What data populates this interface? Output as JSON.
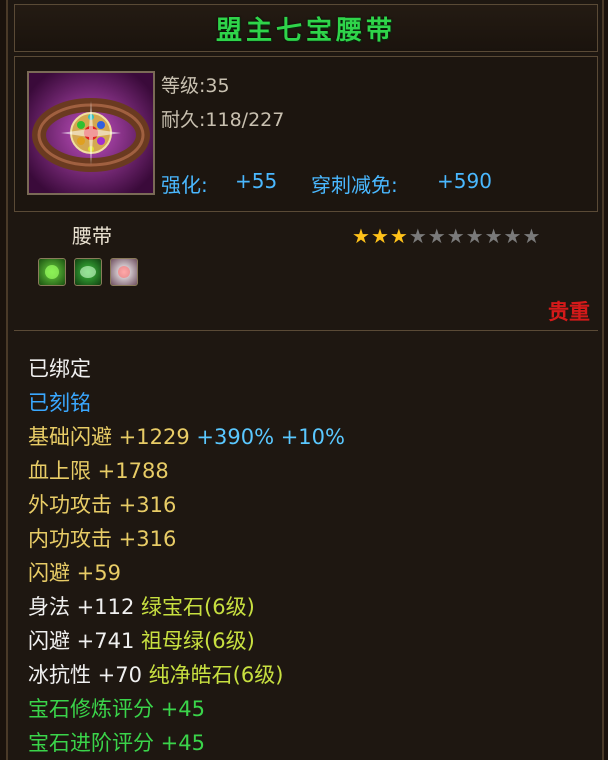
{
  "item": {
    "name": "盟主七宝腰带",
    "level": "等级:35",
    "durability": "耐久:118/227",
    "enhance_label": "强化:",
    "enhance_value": "+55",
    "pierce_label": "穿刺减免:",
    "pierce_value": "+590",
    "type": "腰带",
    "rarity": "贵重",
    "stars_filled": 3,
    "stars_total": 10
  },
  "attributes": [
    {
      "text": "已绑定",
      "color": "white"
    },
    {
      "text": "已刻铭",
      "color": "blue"
    },
    {
      "text": "基础闪避 +1229",
      "extra": " +390% +10%",
      "color": "gold"
    },
    {
      "text": "血上限 +1788",
      "color": "gold"
    },
    {
      "text": "外功攻击 +316",
      "color": "gold"
    },
    {
      "text": "内功攻击 +316",
      "color": "gold"
    },
    {
      "text": "闪避 +59",
      "color": "gold"
    },
    {
      "text": "身法 +112 ",
      "extra": "绿宝石(6级)",
      "color": "white"
    },
    {
      "text": "闪避 +741 ",
      "extra": "祖母绿(6级)",
      "color": "white"
    },
    {
      "text": "冰抗性 +70 ",
      "extra": "纯净皓石(6级)",
      "color": "white"
    },
    {
      "text": "宝石修炼评分 +45",
      "color": "green"
    },
    {
      "text": "宝石进阶评分 +45",
      "color": "green"
    }
  ],
  "colors": {
    "title": "#2fd44a",
    "rarity": "#d41a1a",
    "gold": "#e8cc66",
    "blue": "#3aa8ff"
  }
}
